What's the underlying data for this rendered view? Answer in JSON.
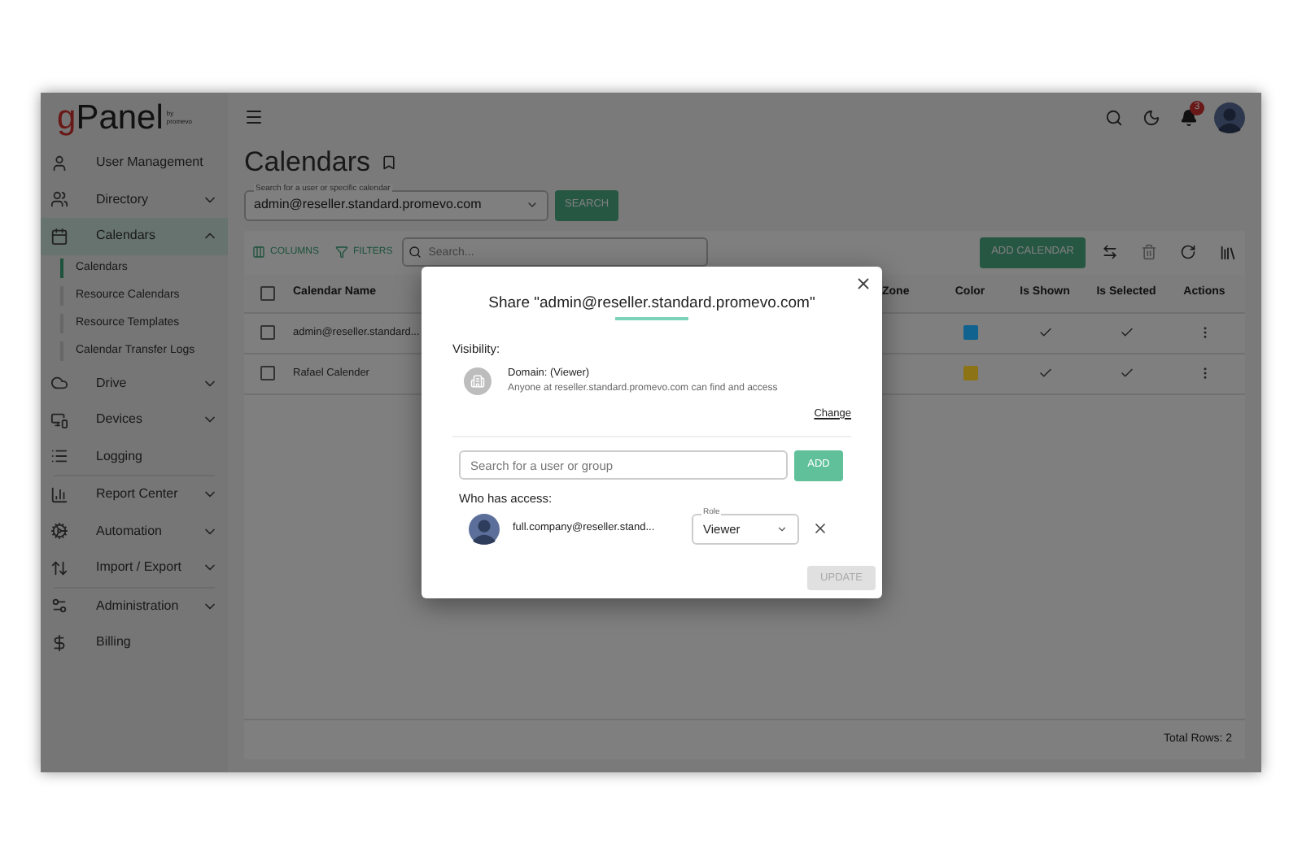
{
  "logo": {
    "mark": "g",
    "rest": "Panel",
    "by": "by",
    "brand": "promevo"
  },
  "sidebar": {
    "items": [
      {
        "label": "User Management",
        "expandable": false,
        "selected": false
      },
      {
        "label": "Directory",
        "expandable": true,
        "expanded": false,
        "selected": false
      },
      {
        "label": "Calendars",
        "expandable": true,
        "expanded": true,
        "selected": true,
        "children": [
          {
            "label": "Calendars",
            "selected": true
          },
          {
            "label": "Resource Calendars",
            "selected": false
          },
          {
            "label": "Resource Templates",
            "selected": false
          },
          {
            "label": "Calendar Transfer Logs",
            "selected": false
          }
        ]
      },
      {
        "label": "Drive",
        "expandable": true,
        "expanded": false,
        "selected": false
      },
      {
        "label": "Devices",
        "expandable": true,
        "expanded": false,
        "selected": false
      },
      {
        "label": "Logging",
        "expandable": false,
        "selected": false
      },
      {
        "label": "Report Center",
        "expandable": true,
        "expanded": false,
        "selected": false
      },
      {
        "label": "Automation",
        "expandable": true,
        "expanded": false,
        "selected": false
      },
      {
        "label": "Import / Export",
        "expandable": true,
        "expanded": false,
        "selected": false
      },
      {
        "label": "Administration",
        "expandable": true,
        "expanded": false,
        "selected": false
      },
      {
        "label": "Billing",
        "expandable": false,
        "selected": false
      }
    ]
  },
  "header": {
    "notification_count": "3"
  },
  "page": {
    "title": "Calendars",
    "calendar_search": {
      "label": "Search for a user or specific calendar",
      "value": "admin@reseller.standard.promevo.com"
    },
    "search_button": "SEARCH"
  },
  "toolbar": {
    "columns": "COLUMNS",
    "filters": "FILTERS",
    "search_placeholder": "Search...",
    "add_button": "ADD CALENDAR"
  },
  "table": {
    "all_checked": false,
    "columns": [
      "Calendar Name",
      "Zone",
      "Color",
      "Is Shown",
      "Is Selected",
      "Actions"
    ],
    "rows": [
      {
        "name": "admin@reseller.standard...",
        "checked": false,
        "color": "#10628f",
        "shown": true,
        "is_selected": true
      },
      {
        "name": "Rafael Calender",
        "checked": false,
        "color": "#8c7316",
        "shown": true,
        "is_selected": true
      }
    ],
    "total": "Total Rows: 2"
  },
  "dialog": {
    "title": "Share \"admin@reseller.standard.promevo.com\"",
    "visibility_label": "Visibility:",
    "domain_title": "Domain: (Viewer)",
    "domain_description": "Anyone at reseller.standard.promevo.com can find and access",
    "change_link": "Change",
    "search_placeholder": "Search for a user or group",
    "add_button": "ADD",
    "access_label": "Who has access:",
    "members": [
      {
        "email": "full.company@reseller.stand...",
        "role_label": "Role",
        "role": "Viewer"
      }
    ],
    "update_button": "UPDATE",
    "update_disabled": true
  }
}
